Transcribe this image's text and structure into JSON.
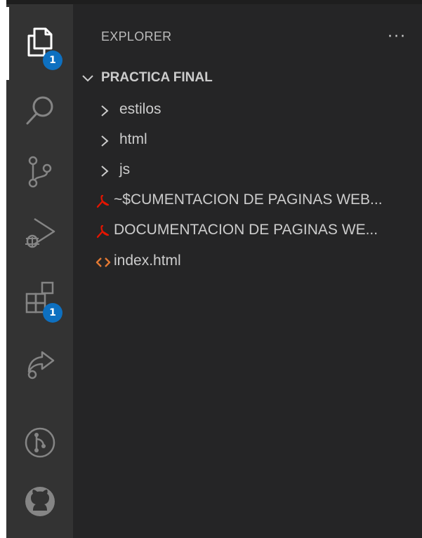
{
  "activity_bar": {
    "items": [
      {
        "name": "explorer",
        "icon": "files-icon",
        "badge": "1",
        "active": true
      },
      {
        "name": "search",
        "icon": "search-icon"
      },
      {
        "name": "source-control",
        "icon": "source-control-icon"
      },
      {
        "name": "run-and-debug",
        "icon": "run-debug-icon"
      },
      {
        "name": "extensions",
        "icon": "extensions-icon",
        "badge": "1"
      },
      {
        "name": "live-share",
        "icon": "live-share-icon"
      },
      {
        "name": "git-graph",
        "icon": "git-graph-icon"
      },
      {
        "name": "github",
        "icon": "github-icon"
      }
    ],
    "badge_color": "#0e70c0"
  },
  "explorer": {
    "title": "EXPLORER",
    "more_actions": "···",
    "folder": {
      "name": "PRACTICA FINAL",
      "items": [
        {
          "type": "folder",
          "label": "estilos"
        },
        {
          "type": "folder",
          "label": "html"
        },
        {
          "type": "folder",
          "label": "js"
        },
        {
          "type": "pdf-file",
          "label": "~$CUMENTACION DE PAGINAS WEB..."
        },
        {
          "type": "pdf-file",
          "label": "DOCUMENTACION DE PAGINAS WE..."
        },
        {
          "type": "html-file",
          "label": "index.html"
        }
      ]
    }
  },
  "colors": {
    "pdf_icon": "#e51400",
    "html_icon": "#e37933",
    "text": "#cccccc"
  }
}
